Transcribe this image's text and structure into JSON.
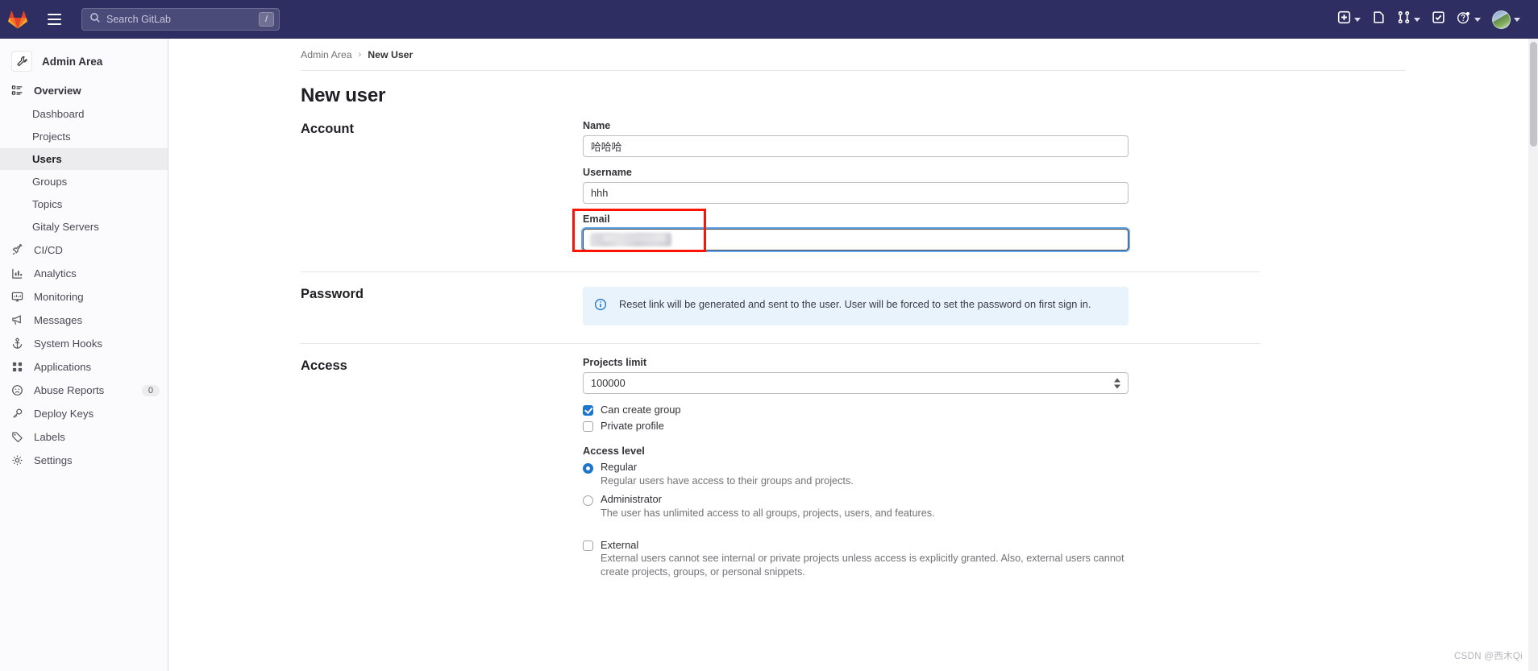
{
  "topbar": {
    "logo_icon": "gitlab-logo-icon",
    "menu_icon": "hamburger-menu-icon",
    "search": {
      "placeholder": "Search GitLab",
      "icon": "search-icon",
      "shortcut": "/"
    },
    "actions": [
      {
        "name": "create-new-menu",
        "icon": "plus-square-icon",
        "has_caret": true
      },
      {
        "name": "issues-link",
        "icon": "issues-icon",
        "has_caret": false
      },
      {
        "name": "merge-requests-menu",
        "icon": "merge-request-icon",
        "has_caret": true
      },
      {
        "name": "todos-link",
        "icon": "todo-check-icon",
        "has_caret": false
      },
      {
        "name": "help-menu",
        "icon": "question-circle-icon",
        "has_caret": true
      },
      {
        "name": "user-menu",
        "icon": "avatar",
        "has_caret": true
      }
    ]
  },
  "sidebar": {
    "header": {
      "label": "Admin Area",
      "icon": "wrench-icon"
    },
    "overview": {
      "label": "Overview",
      "icon": "overview-list-icon"
    },
    "sub_items": [
      {
        "label": "Dashboard",
        "active": false
      },
      {
        "label": "Projects",
        "active": false
      },
      {
        "label": "Users",
        "active": true
      },
      {
        "label": "Groups",
        "active": false
      },
      {
        "label": "Topics",
        "active": false
      },
      {
        "label": "Gitaly Servers",
        "active": false
      }
    ],
    "items": [
      {
        "label": "CI/CD",
        "icon": "rocket-icon",
        "badge": ""
      },
      {
        "label": "Analytics",
        "icon": "chart-bar-icon",
        "badge": ""
      },
      {
        "label": "Monitoring",
        "icon": "monitor-icon",
        "badge": ""
      },
      {
        "label": "Messages",
        "icon": "megaphone-icon",
        "badge": ""
      },
      {
        "label": "System Hooks",
        "icon": "anchor-icon",
        "badge": ""
      },
      {
        "label": "Applications",
        "icon": "grid-apps-icon",
        "badge": ""
      },
      {
        "label": "Abuse Reports",
        "icon": "sad-face-icon",
        "badge": "0"
      },
      {
        "label": "Deploy Keys",
        "icon": "key-icon",
        "badge": ""
      },
      {
        "label": "Labels",
        "icon": "tag-icon",
        "badge": ""
      },
      {
        "label": "Settings",
        "icon": "gear-icon",
        "badge": ""
      }
    ]
  },
  "breadcrumb": {
    "root": "Admin Area",
    "separator": "›",
    "current": "New User"
  },
  "page": {
    "title": "New user"
  },
  "account": {
    "section_title": "Account",
    "name": {
      "label": "Name",
      "value": "哈哈哈"
    },
    "username": {
      "label": "Username",
      "value": "hhh"
    },
    "email": {
      "label": "Email",
      "value": "",
      "redacted": true,
      "focused": true,
      "highlighted": true
    }
  },
  "password": {
    "section_title": "Password",
    "alert": {
      "icon": "info-circle-icon",
      "text": "Reset link will be generated and sent to the user. User will be forced to set the password on first sign in."
    }
  },
  "access": {
    "section_title": "Access",
    "projects_limit": {
      "label": "Projects limit",
      "value": "100000"
    },
    "checkboxes": [
      {
        "label": "Can create group",
        "checked": true
      },
      {
        "label": "Private profile",
        "checked": false
      }
    ],
    "access_level": {
      "label": "Access level",
      "options": [
        {
          "label": "Regular",
          "selected": true,
          "hint": "Regular users have access to their groups and projects."
        },
        {
          "label": "Administrator",
          "selected": false,
          "hint": "The user has unlimited access to all groups, projects, users, and features."
        }
      ]
    },
    "external": {
      "label": "External",
      "checked": false,
      "hint": "External users cannot see internal or private projects unless access is explicitly granted. Also, external users cannot create projects, groups, or personal snippets."
    }
  },
  "watermark": "CSDN @西木Qi",
  "colors": {
    "navbar": "#2e2e63",
    "accent": "#1f75cb",
    "highlight": "#fc1405",
    "alert_bg": "#e9f3fc"
  }
}
